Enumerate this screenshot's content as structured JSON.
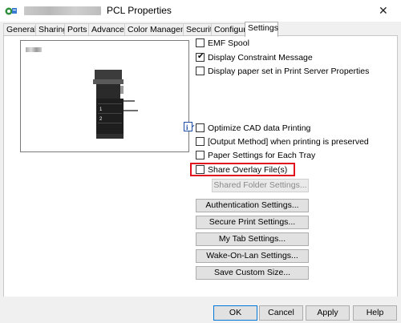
{
  "window": {
    "title_text": "PCL Properties"
  },
  "tabs": [
    {
      "label": "General"
    },
    {
      "label": "Sharing"
    },
    {
      "label": "Ports"
    },
    {
      "label": "Advanced"
    },
    {
      "label": "Color Management"
    },
    {
      "label": "Security"
    },
    {
      "label": "Configure"
    },
    {
      "label": "Settings",
      "active": true
    }
  ],
  "options_top": [
    {
      "label": "EMF Spool",
      "checked": false
    },
    {
      "label": "Display Constraint Message",
      "checked": true
    },
    {
      "label": "Display paper set in Print Server Properties",
      "checked": false
    }
  ],
  "options_mid": [
    {
      "label": "Optimize CAD data Printing",
      "checked": false
    },
    {
      "label": "[Output Method] when printing is preserved",
      "checked": false
    },
    {
      "label": "Paper Settings for Each Tray",
      "checked": false
    },
    {
      "label": "Share Overlay File(s)",
      "checked": false
    }
  ],
  "buttons": {
    "shared_folder": "Shared Folder Settings...",
    "authentication": "Authentication Settings...",
    "secure_print": "Secure Print Settings...",
    "my_tab": "My Tab Settings...",
    "wake_on_lan": "Wake-On-Lan Settings...",
    "save_custom_size": "Save Custom Size..."
  },
  "footer": {
    "ok": "OK",
    "cancel": "Cancel",
    "apply": "Apply",
    "help": "Help"
  },
  "icons": {
    "title": "printer-properties-icon",
    "close": "close-icon",
    "info": "information-icon"
  },
  "colors": {
    "highlight_border": "#e0141e",
    "panel_bg": "#ffffff",
    "window_bg": "#f0f0f0"
  }
}
